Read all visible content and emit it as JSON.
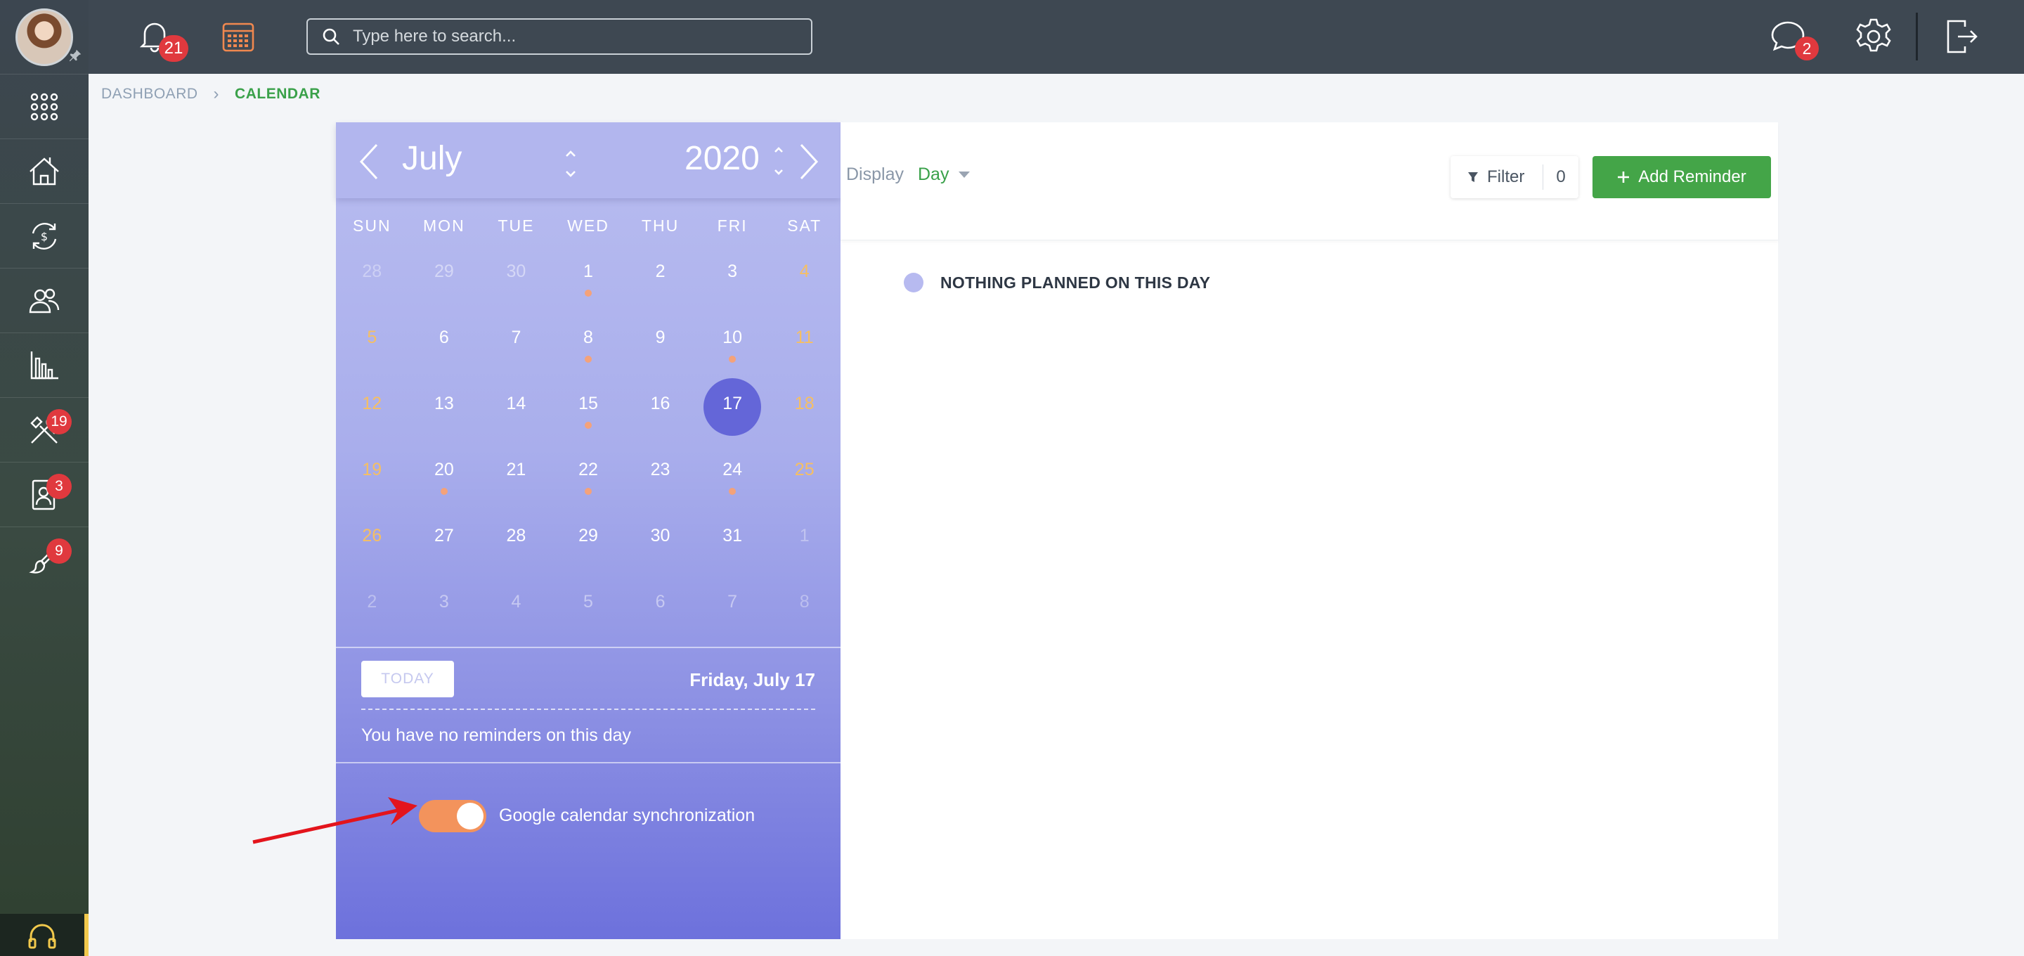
{
  "topbar": {
    "notifications_count": "21",
    "search_placeholder": "Type here to search...",
    "messages_count": "2"
  },
  "sidebar": {
    "items": [
      {
        "icon": "apps-grid-icon",
        "badge": ""
      },
      {
        "icon": "house-icon",
        "badge": ""
      },
      {
        "icon": "money-cycle-icon",
        "badge": ""
      },
      {
        "icon": "people-icon",
        "badge": ""
      },
      {
        "icon": "bar-chart-icon",
        "badge": ""
      },
      {
        "icon": "tools-icon",
        "badge": "19"
      },
      {
        "icon": "contact-card-icon",
        "badge": "3"
      },
      {
        "icon": "brush-icon",
        "badge": "9"
      }
    ]
  },
  "breadcrumb": {
    "root": "DASHBOARD",
    "current": "CALENDAR"
  },
  "calendar": {
    "month": "July",
    "year": "2020",
    "weekdays": [
      "SUN",
      "MON",
      "TUE",
      "WED",
      "THU",
      "FRI",
      "SAT"
    ],
    "selected_day": "17",
    "today_label": "TODAY",
    "selected_date_text": "Friday, July 17",
    "no_reminders_text": "You have no reminders on this day",
    "sync_label": "Google calendar synchronization",
    "sync_enabled": true,
    "colors": {
      "accent_selected": "#6466d8",
      "weekend": "#f6bf62",
      "dot": "#f4a27a",
      "toggle": "#f3935c"
    }
  },
  "weeks": [
    [
      {
        "d": "28",
        "m": true
      },
      {
        "d": "29",
        "m": true
      },
      {
        "d": "30",
        "m": true
      },
      {
        "d": "1",
        "dot": true
      },
      {
        "d": "2"
      },
      {
        "d": "3"
      },
      {
        "d": "4"
      }
    ],
    [
      {
        "d": "5"
      },
      {
        "d": "6"
      },
      {
        "d": "7"
      },
      {
        "d": "8",
        "dot": true
      },
      {
        "d": "9"
      },
      {
        "d": "10",
        "dot": true
      },
      {
        "d": "11"
      }
    ],
    [
      {
        "d": "12"
      },
      {
        "d": "13"
      },
      {
        "d": "14"
      },
      {
        "d": "15",
        "dot": true
      },
      {
        "d": "16"
      },
      {
        "d": "17",
        "sel": true
      },
      {
        "d": "18"
      }
    ],
    [
      {
        "d": "19"
      },
      {
        "d": "20",
        "dot": true
      },
      {
        "d": "21"
      },
      {
        "d": "22",
        "dot": true
      },
      {
        "d": "23"
      },
      {
        "d": "24",
        "dot": true
      },
      {
        "d": "25"
      }
    ],
    [
      {
        "d": "26"
      },
      {
        "d": "27"
      },
      {
        "d": "28"
      },
      {
        "d": "29"
      },
      {
        "d": "30"
      },
      {
        "d": "31"
      },
      {
        "d": "1",
        "m": true
      }
    ],
    [
      {
        "d": "2",
        "m": true
      },
      {
        "d": "3",
        "m": true
      },
      {
        "d": "4",
        "m": true
      },
      {
        "d": "5",
        "m": true
      },
      {
        "d": "6",
        "m": true
      },
      {
        "d": "7",
        "m": true
      },
      {
        "d": "8",
        "m": true
      }
    ]
  ],
  "panel": {
    "display_label": "Display",
    "display_value": "Day",
    "filter_label": "Filter",
    "filter_count": "0",
    "add_reminder_label": "Add Reminder",
    "empty_text": "NOTHING PLANNED ON THIS DAY"
  }
}
